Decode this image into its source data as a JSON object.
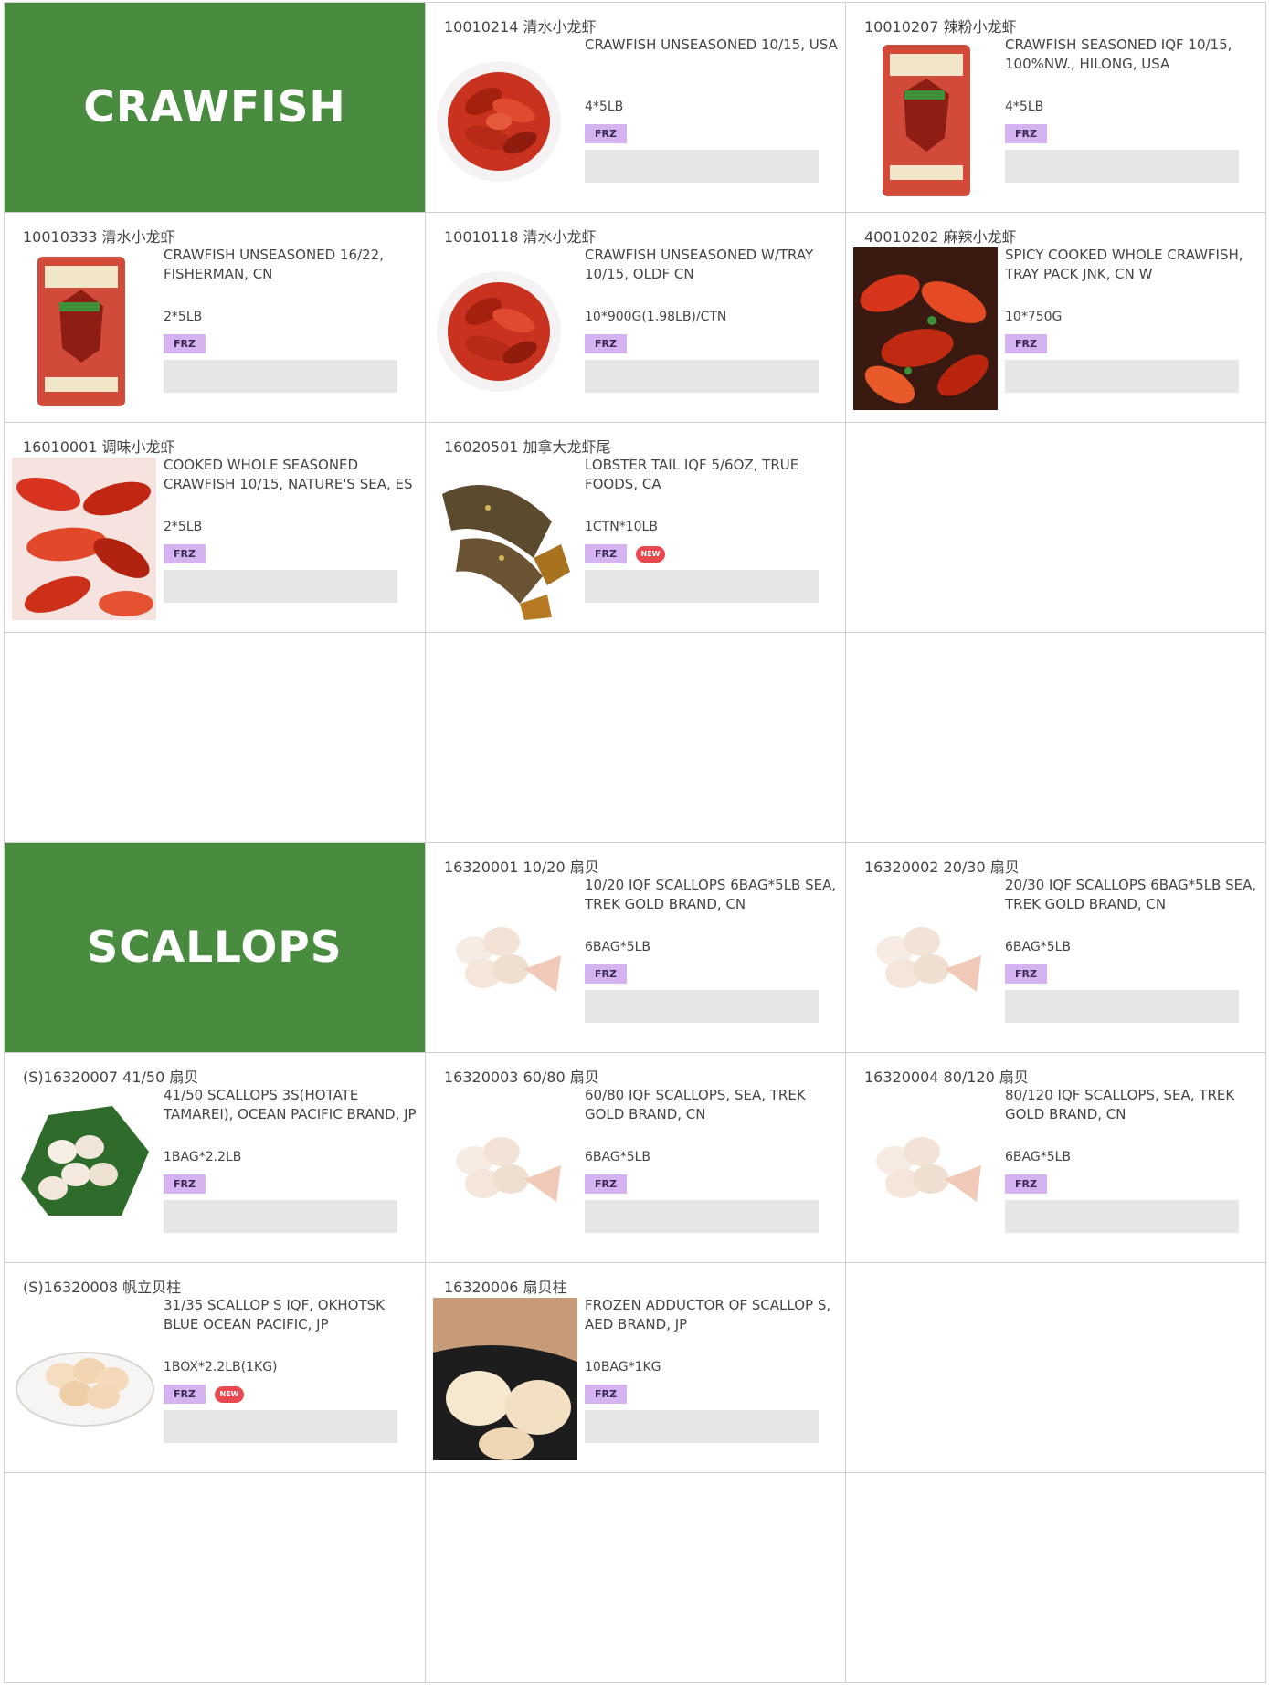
{
  "crawfish_header": "CRAWFISH",
  "scallops_header": "SCALLOPS",
  "crawfish_products": [
    {
      "code": "10010214 清水小龙虾",
      "desc": "CRAWFISH UNSEASONED 10/15, USA",
      "pack": "4*5LB",
      "tag": "FRZ"
    },
    {
      "code": "10010207 辣粉小龙虾",
      "desc": "CRAWFISH SEASONED IQF 10/15, 100%NW., HILONG, USA",
      "pack": "4*5LB",
      "tag": "FRZ"
    },
    {
      "code": "10010333 清水小龙虾",
      "desc": "CRAWFISH UNSEASONED 16/22, FISHERMAN, CN",
      "pack": "2*5LB",
      "tag": "FRZ"
    },
    {
      "code": "10010118 清水小龙虾",
      "desc": "CRAWFISH UNSEASONED W/TRAY 10/15, OLDF CN",
      "pack": "10*900G(1.98LB)/CTN",
      "tag": "FRZ"
    },
    {
      "code": "40010202 麻辣小龙虾",
      "desc": "SPICY COOKED WHOLE CRAWFISH, TRAY PACK JNK, CN W",
      "pack": "10*750G",
      "tag": "FRZ"
    },
    {
      "code": "16010001 调味小龙虾",
      "desc": "COOKED WHOLE SEASONED CRAWFISH 10/15, NATURE'S SEA, ES",
      "pack": "2*5LB",
      "tag": "FRZ"
    },
    {
      "code": "16020501 加拿大龙虾尾",
      "desc": "LOBSTER TAIL IQF 5/6OZ, TRUE FOODS, CA",
      "pack": "1CTN*10LB",
      "tag": "FRZ",
      "new": "NEW"
    }
  ],
  "scallop_products": [
    {
      "code": "16320001 10/20 扇贝",
      "desc": "10/20 IQF SCALLOPS 6BAG*5LB SEA, TREK GOLD BRAND, CN",
      "pack": "6BAG*5LB",
      "tag": "FRZ"
    },
    {
      "code": "16320002 20/30 扇贝",
      "desc": "20/30 IQF SCALLOPS 6BAG*5LB SEA, TREK GOLD BRAND, CN",
      "pack": "6BAG*5LB",
      "tag": "FRZ"
    },
    {
      "code": "(S)16320007 41/50 扇贝",
      "desc": "41/50 SCALLOPS 3S(HOTATE TAMAREI), OCEAN PACIFIC BRAND, JP",
      "pack": "1BAG*2.2LB",
      "tag": "FRZ"
    },
    {
      "code": "16320003 60/80 扇贝",
      "desc": "60/80 IQF SCALLOPS, SEA, TREK GOLD BRAND, CN",
      "pack": "6BAG*5LB",
      "tag": "FRZ"
    },
    {
      "code": "16320004 80/120 扇贝",
      "desc": "80/120 IQF SCALLOPS, SEA, TREK GOLD BRAND, CN",
      "pack": "6BAG*5LB",
      "tag": "FRZ"
    },
    {
      "code": "(S)16320008 帆立贝柱",
      "desc": "31/35 SCALLOP S IQF, OKHOTSK BLUE OCEAN PACIFIC, JP",
      "pack": "1BOX*2.2LB(1KG)",
      "tag": "FRZ",
      "new": "NEW"
    },
    {
      "code": "16320006 扇贝柱",
      "desc": "FROZEN ADDUCTOR OF SCALLOP S, AED BRAND, JP",
      "pack": "10BAG*1KG",
      "tag": "FRZ"
    }
  ],
  "colors": {
    "header_green": "#4a8c3f",
    "frz_tag": "#d4b3f0",
    "new_tag": "#e8494f",
    "placeholder_bar": "#e6e6e6"
  }
}
